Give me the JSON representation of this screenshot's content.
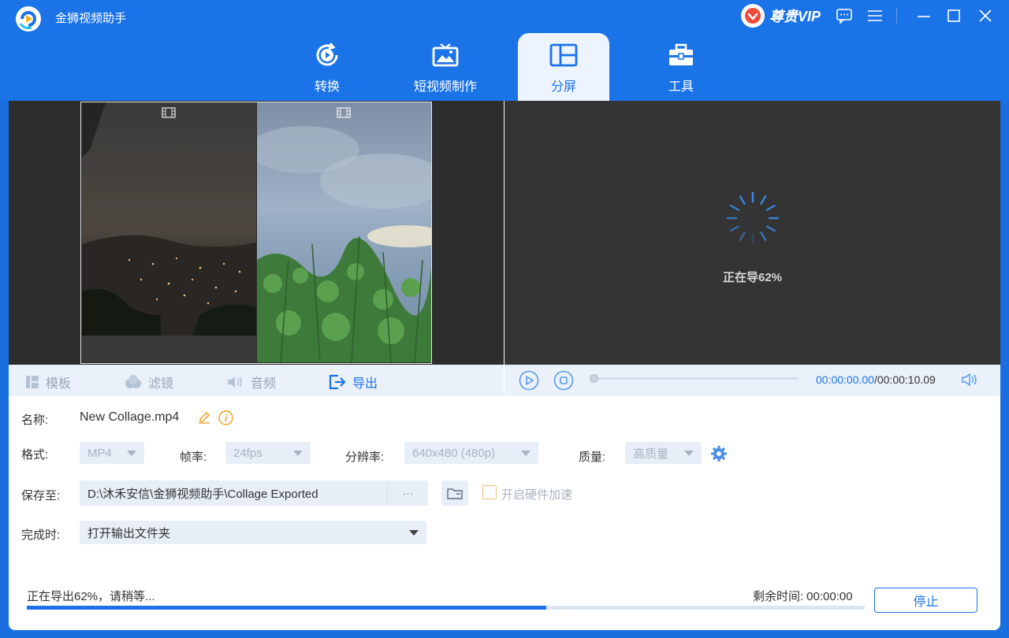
{
  "window": {
    "title": "金狮视频助手",
    "vip_label": "尊贵VIP"
  },
  "nav": {
    "tabs": [
      {
        "label": "转换",
        "icon": "convert-icon"
      },
      {
        "label": "短视频制作",
        "icon": "tv-icon"
      },
      {
        "label": "分屏",
        "icon": "split-screen-icon"
      },
      {
        "label": "工具",
        "icon": "toolbox-icon"
      }
    ],
    "active": "分屏"
  },
  "preview": {
    "status": "正在导62%"
  },
  "editor_tabs": [
    {
      "label": "模板",
      "icon": "template-icon"
    },
    {
      "label": "滤镜",
      "icon": "filter-icon"
    },
    {
      "label": "音频",
      "icon": "audio-icon"
    },
    {
      "label": "导出",
      "icon": "export-icon"
    }
  ],
  "player": {
    "time_current": "00:00:00.00",
    "time_total": "/00:00:10.09",
    "position": 0
  },
  "export": {
    "name_label": "名称:",
    "name_value": "New Collage.mp4",
    "format_label": "格式:",
    "format_value": "MP4",
    "fps_label": "帧率:",
    "fps_value": "24fps",
    "resolution_label": "分辨率:",
    "resolution_value": "640x480 (480p)",
    "quality_label": "质量:",
    "quality_value": "高质量",
    "save_label": "保存至:",
    "save_path": "D:\\沐禾安信\\金狮视频助手\\Collage Exported",
    "browse_label": "···",
    "hw_accel_label": "开启硬件加速",
    "hw_accel_checked": false,
    "complete_label": "完成时:",
    "complete_value": "打开输出文件夹"
  },
  "progress": {
    "status_text": "正在导出62%，请稍等...",
    "remaining_label": "剩余时间:",
    "remaining_value": "00:00:00",
    "percent": 62,
    "stop_label": "停止"
  },
  "colors": {
    "accent": "#1b73e8",
    "titlebar": "#1b73e8"
  }
}
